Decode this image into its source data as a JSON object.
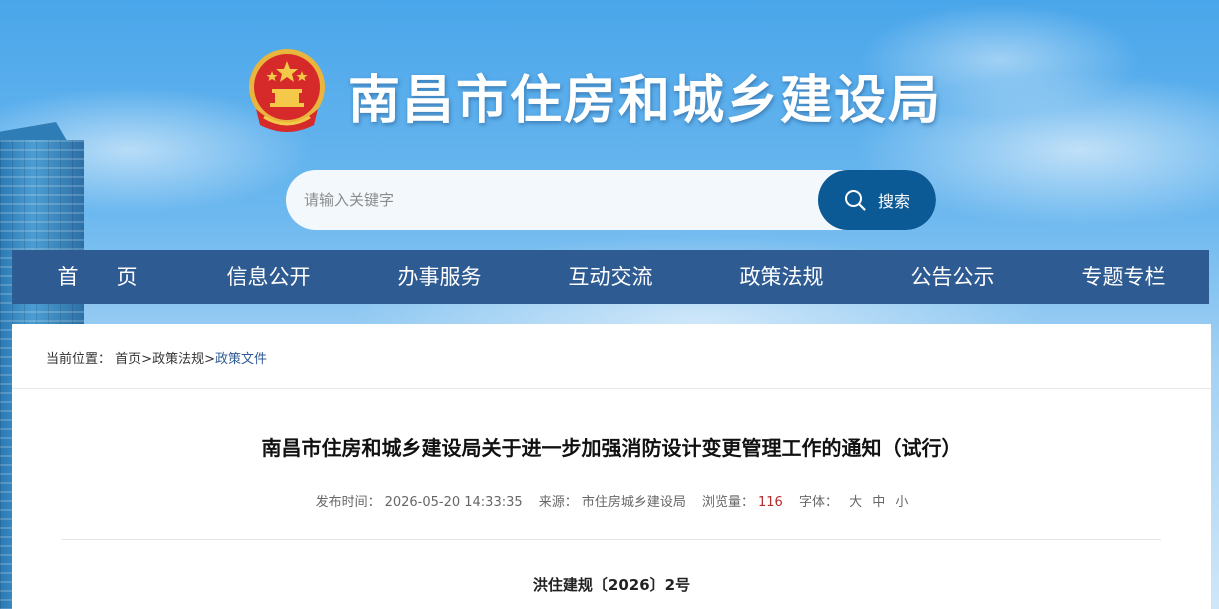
{
  "header": {
    "site_title": "南昌市住房和城乡建设局"
  },
  "search": {
    "placeholder": "请输入关键字",
    "button_label": "搜索",
    "icon": "search-icon"
  },
  "nav": {
    "items": [
      {
        "label": "首页"
      },
      {
        "label": "信息公开"
      },
      {
        "label": "办事服务"
      },
      {
        "label": "互动交流"
      },
      {
        "label": "政策法规"
      },
      {
        "label": "公告公示"
      },
      {
        "label": "专题专栏"
      }
    ]
  },
  "breadcrumb": {
    "prefix": "当前位置：",
    "items": [
      "首页",
      "政策法规",
      "政策文件"
    ]
  },
  "article": {
    "title": "南昌市住房和城乡建设局关于进一步加强消防设计变更管理工作的通知（试行）",
    "publish_label": "发布时间：",
    "publish_time": "2026-05-20 14:33:35",
    "source_label": "来源：",
    "source": "市住房城乡建设局",
    "views_label": "浏览量：",
    "views": "116",
    "font_label": "字体：",
    "font_sizes": [
      "大",
      "中",
      "小"
    ],
    "doc_number": "洪住建规〔2026〕2号"
  },
  "colors": {
    "nav_bg": "#2f5b93",
    "search_button": "#0c5a95",
    "views_accent": "#b32b2b"
  }
}
